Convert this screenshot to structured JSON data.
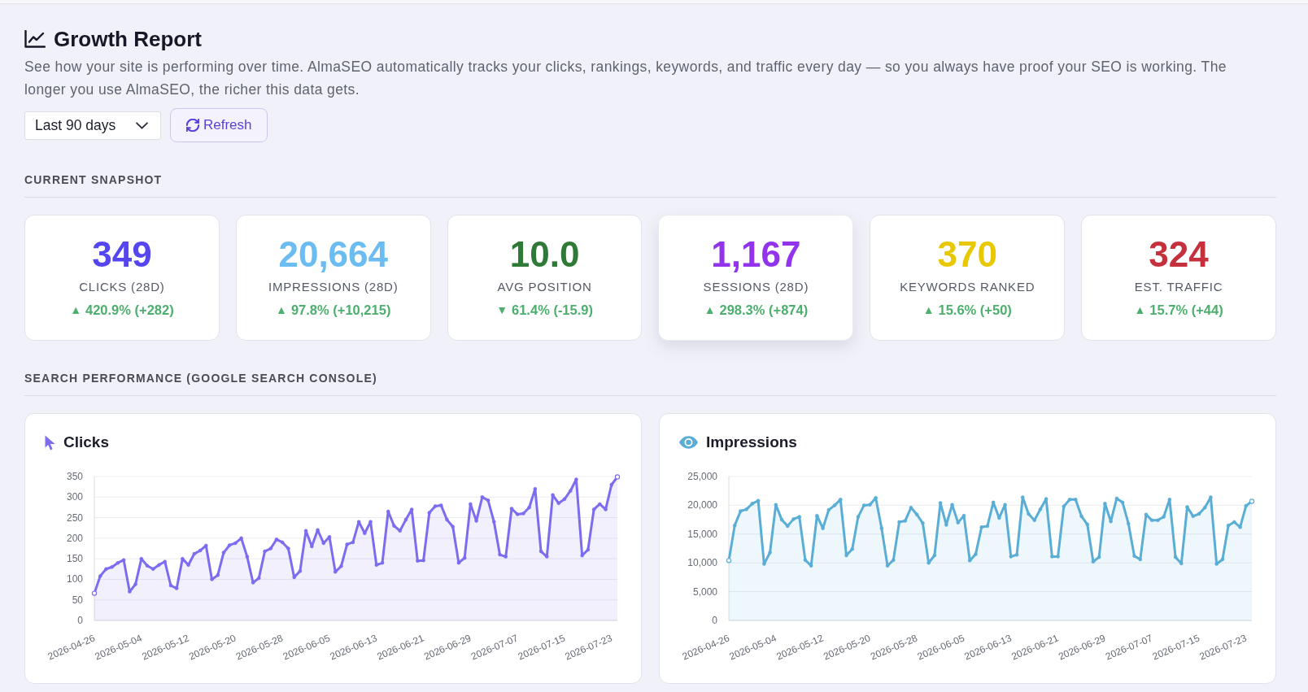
{
  "header": {
    "title": "Growth Report",
    "description": "See how your site is performing over time. AlmaSEO automatically tracks your clicks, rankings, keywords, and traffic every day — so you always have proof your SEO is working. The longer you use AlmaSEO, the richer this data gets."
  },
  "controls": {
    "date_range": "Last 90 days",
    "refresh_label": "Refresh"
  },
  "snapshot": {
    "heading": "CURRENT SNAPSHOT",
    "cards": [
      {
        "value": "349",
        "label": "CLICKS (28D)",
        "arrow": "▲",
        "change": "420.9% (+282)",
        "color": "#5546f0",
        "hovered": false
      },
      {
        "value": "20,664",
        "label": "IMPRESSIONS (28D)",
        "arrow": "▲",
        "change": "97.8% (+10,215)",
        "color": "#6bbcf0",
        "hovered": false
      },
      {
        "value": "10.0",
        "label": "AVG POSITION",
        "arrow": "▼",
        "change": "61.4% (-15.9)",
        "color": "#2f7a36",
        "hovered": false
      },
      {
        "value": "1,167",
        "label": "SESSIONS (28D)",
        "arrow": "▲",
        "change": "298.3% (+874)",
        "color": "#9234ec",
        "hovered": true
      },
      {
        "value": "370",
        "label": "KEYWORDS RANKED",
        "arrow": "▲",
        "change": "15.6% (+50)",
        "color": "#e8c800",
        "hovered": false
      },
      {
        "value": "324",
        "label": "EST. TRAFFIC",
        "arrow": "▲",
        "change": "15.7% (+44)",
        "color": "#c4303c",
        "hovered": false
      }
    ]
  },
  "search_performance": {
    "heading": "SEARCH PERFORMANCE (GOOGLE SEARCH CONSOLE)",
    "charts": [
      {
        "chart_data": {
          "type": "area",
          "title": "Clicks",
          "grid": true,
          "categories": [
            "2026-04-26",
            null,
            null,
            null,
            null,
            null,
            null,
            null,
            "2026-05-04",
            null,
            null,
            null,
            null,
            null,
            null,
            null,
            "2026-05-12",
            null,
            null,
            null,
            null,
            null,
            null,
            null,
            "2026-05-20",
            null,
            null,
            null,
            null,
            null,
            null,
            null,
            "2026-05-28",
            null,
            null,
            null,
            null,
            null,
            null,
            null,
            "2026-06-05",
            null,
            null,
            null,
            null,
            null,
            null,
            null,
            "2026-06-13",
            null,
            null,
            null,
            null,
            null,
            null,
            null,
            "2026-06-21",
            null,
            null,
            null,
            null,
            null,
            null,
            null,
            "2026-06-29",
            null,
            null,
            null,
            null,
            null,
            null,
            null,
            "2026-07-07",
            null,
            null,
            null,
            null,
            null,
            null,
            null,
            "2026-07-15",
            null,
            null,
            null,
            null,
            null,
            null,
            null,
            "2026-07-23",
            null
          ],
          "ylim": [
            0,
            350
          ],
          "yticks": [
            0,
            50,
            100,
            150,
            200,
            250,
            300,
            350
          ],
          "series": [
            {
              "color": "#7b6cf0",
              "values": [
                66,
                108,
                125,
                130,
                140,
                147,
                70,
                88,
                150,
                133,
                125,
                135,
                143,
                85,
                78,
                150,
                135,
                162,
                170,
                182,
                100,
                110,
                165,
                183,
                188,
                200,
                155,
                92,
                103,
                168,
                175,
                197,
                190,
                175,
                105,
                120,
                218,
                180,
                220,
                188,
                203,
                118,
                132,
                185,
                190,
                240,
                212,
                240,
                135,
                140,
                265,
                230,
                218,
                245,
                270,
                145,
                146,
                262,
                278,
                280,
                245,
                228,
                140,
                152,
                283,
                242,
                300,
                292,
                240,
                160,
                155,
                272,
                258,
                260,
                275,
                320,
                168,
                155,
                305,
                285,
                295,
                315,
                343,
                158,
                172,
                270,
                283,
                270,
                330,
                349
              ]
            }
          ]
        }
      },
      {
        "chart_data": {
          "type": "area",
          "title": "Impressions",
          "grid": true,
          "categories": [
            "2026-04-26",
            null,
            null,
            null,
            null,
            null,
            null,
            null,
            "2026-05-04",
            null,
            null,
            null,
            null,
            null,
            null,
            null,
            "2026-05-12",
            null,
            null,
            null,
            null,
            null,
            null,
            null,
            "2026-05-20",
            null,
            null,
            null,
            null,
            null,
            null,
            null,
            "2026-05-28",
            null,
            null,
            null,
            null,
            null,
            null,
            null,
            "2026-06-05",
            null,
            null,
            null,
            null,
            null,
            null,
            null,
            "2026-06-13",
            null,
            null,
            null,
            null,
            null,
            null,
            null,
            "2026-06-21",
            null,
            null,
            null,
            null,
            null,
            null,
            null,
            "2026-06-29",
            null,
            null,
            null,
            null,
            null,
            null,
            null,
            "2026-07-07",
            null,
            null,
            null,
            null,
            null,
            null,
            null,
            "2026-07-15",
            null,
            null,
            null,
            null,
            null,
            null,
            null,
            "2026-07-23",
            null
          ],
          "ylim": [
            0,
            25000
          ],
          "yticks": [
            {
              "value": 0,
              "label": "0"
            },
            {
              "value": 5000,
              "label": "5,000"
            },
            {
              "value": 10000,
              "label": "10,000"
            },
            {
              "value": 15000,
              "label": "15,000"
            },
            {
              "value": 20000,
              "label": "20,000"
            },
            {
              "value": 25000,
              "label": "25,000"
            }
          ],
          "series": [
            {
              "color": "#5aaed6",
              "values": [
                10400,
                16500,
                19000,
                19300,
                20300,
                20800,
                9800,
                11800,
                20100,
                17500,
                16400,
                17600,
                18000,
                10500,
                9500,
                18200,
                16000,
                19200,
                20000,
                21000,
                11300,
                12400,
                18000,
                20000,
                20100,
                21300,
                16000,
                9500,
                10500,
                17100,
                17300,
                19600,
                18400,
                16900,
                10000,
                11300,
                20400,
                16600,
                20100,
                17000,
                18200,
                10400,
                11500,
                16200,
                16400,
                20500,
                17800,
                20100,
                11100,
                11400,
                21400,
                18500,
                17400,
                19300,
                21100,
                11100,
                11100,
                19800,
                21000,
                21000,
                18100,
                16700,
                10200,
                11000,
                20300,
                17200,
                21200,
                20500,
                16800,
                11200,
                10600,
                18400,
                17400,
                17400,
                18000,
                21000,
                11000,
                9900,
                19700,
                18100,
                18500,
                19600,
                21400,
                9800,
                10600,
                16500,
                17100,
                16200,
                19900,
                20700
              ]
            }
          ]
        }
      }
    ]
  }
}
